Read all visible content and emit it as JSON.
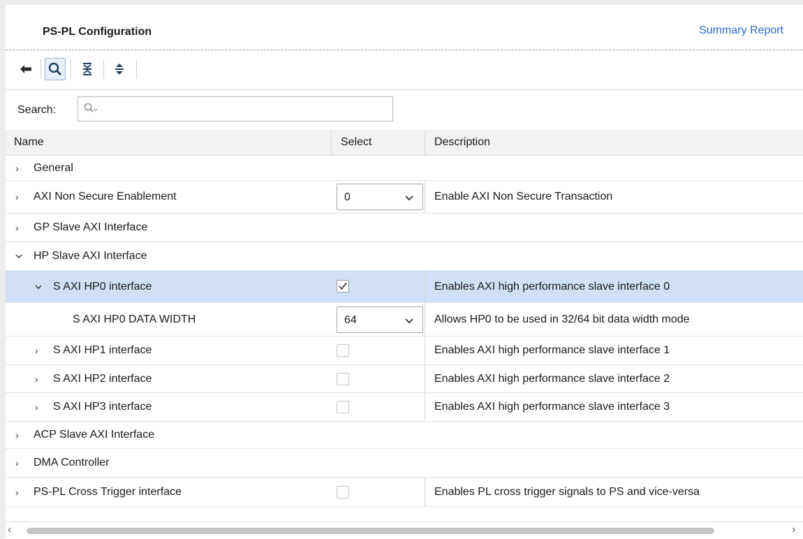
{
  "header": {
    "title": "PS-PL Configuration",
    "summary_link": "Summary Report"
  },
  "toolbar": {
    "buttons": [
      "back-arrow-icon",
      "search-icon",
      "collapse-all-icon",
      "expand-all-icon"
    ]
  },
  "search": {
    "label": "Search:",
    "placeholder": ""
  },
  "table": {
    "columns": {
      "name": "Name",
      "select": "Select",
      "description": "Description"
    },
    "rows": {
      "general": {
        "name": "General"
      },
      "axi_non_secure": {
        "name": "AXI Non Secure Enablement",
        "select": "0",
        "description": "Enable AXI Non Secure Transaction"
      },
      "gp_slave": {
        "name": "GP Slave AXI Interface"
      },
      "hp_slave": {
        "name": "HP Slave AXI Interface"
      },
      "hp0": {
        "name": "S AXI HP0 interface",
        "checked": true,
        "description": "Enables AXI high performance slave interface 0"
      },
      "hp0_width": {
        "name": "S AXI HP0 DATA WIDTH",
        "select": "64",
        "description": "Allows HP0 to be used in 32/64 bit data width mode"
      },
      "hp1": {
        "name": "S AXI HP1 interface",
        "checked": false,
        "description": "Enables AXI high performance slave interface 1"
      },
      "hp2": {
        "name": "S AXI HP2 interface",
        "checked": false,
        "description": "Enables AXI high performance slave interface 2"
      },
      "hp3": {
        "name": "S AXI HP3 interface",
        "checked": false,
        "description": "Enables AXI high performance slave interface 3"
      },
      "acp_slave": {
        "name": "ACP Slave AXI Interface"
      },
      "dma": {
        "name": "DMA Controller"
      },
      "cross_trigger": {
        "name": "PS-PL Cross Trigger interface",
        "checked": false,
        "description": "Enables PL cross trigger signals to PS and vice-versa"
      }
    }
  },
  "colors": {
    "selected_row": "#cfe0f7",
    "link": "#2a6ad4"
  }
}
